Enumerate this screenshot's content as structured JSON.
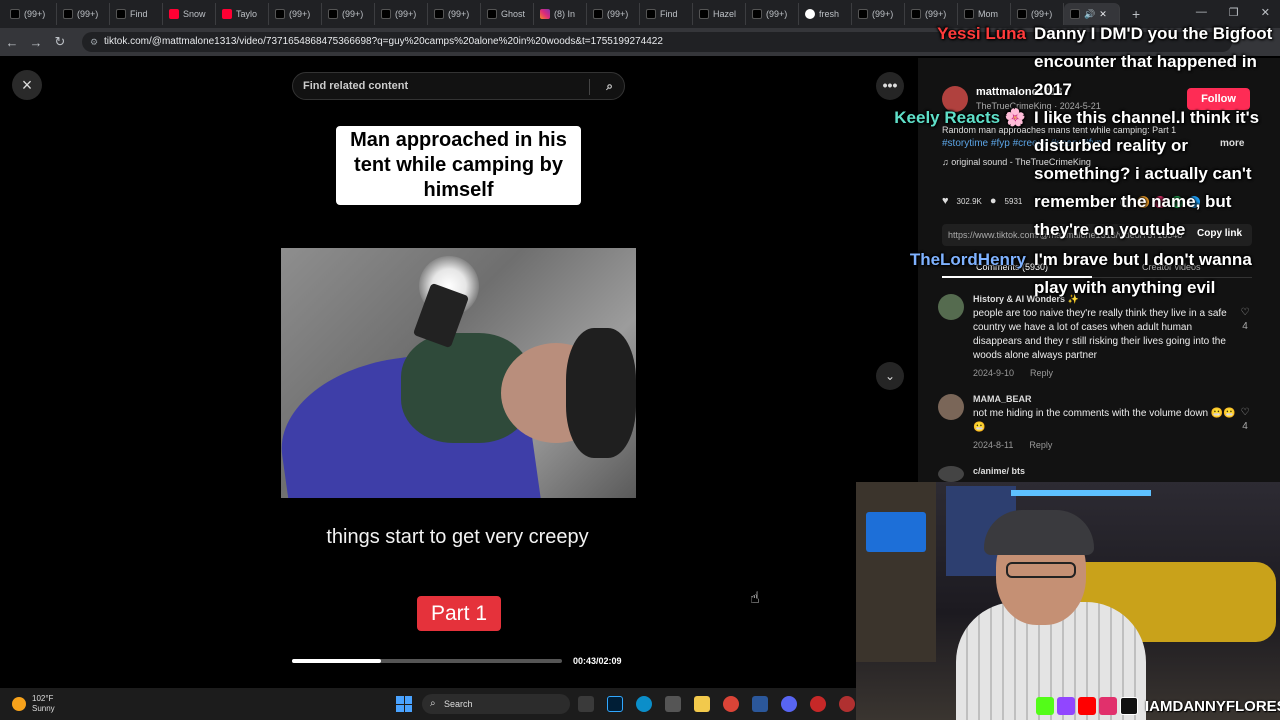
{
  "browser": {
    "tabs": [
      {
        "label": "(99+)",
        "icon": "tiktok"
      },
      {
        "label": "(99+)",
        "icon": "tiktok"
      },
      {
        "label": "Find",
        "icon": "tiktok"
      },
      {
        "label": "Snow",
        "icon": "youtube"
      },
      {
        "label": "Taylo",
        "icon": "youtube"
      },
      {
        "label": "(99+)",
        "icon": "tiktok"
      },
      {
        "label": "(99+)",
        "icon": "tiktok"
      },
      {
        "label": "(99+)",
        "icon": "tiktok"
      },
      {
        "label": "(99+)",
        "icon": "tiktok"
      },
      {
        "label": "Ghost",
        "icon": "tiktok"
      },
      {
        "label": "(8) In",
        "icon": "instagram"
      },
      {
        "label": "(99+)",
        "icon": "tiktok"
      },
      {
        "label": "Find",
        "icon": "tiktok"
      },
      {
        "label": "Hazel",
        "icon": "tiktok"
      },
      {
        "label": "(99+)",
        "icon": "tiktok"
      },
      {
        "label": "fresh",
        "icon": "google"
      },
      {
        "label": "(99+)",
        "icon": "tiktok"
      },
      {
        "label": "(99+)",
        "icon": "tiktok"
      },
      {
        "label": "Mom",
        "icon": "tiktok"
      },
      {
        "label": "(99+)",
        "icon": "tiktok"
      }
    ],
    "url": "tiktok.com/@mattmalone1313/video/7371654868475366698?q=guy%20camps%20alone%20in%20woods&t=1755199274422"
  },
  "viewer": {
    "close_icon": "×",
    "search_placeholder": "Find related content",
    "caption_top": "Man approached in his tent while camping by himself",
    "caption_bottom": "things start to get very creepy",
    "part_label": "Part 1",
    "progress_fraction": 0.33,
    "timecode": "00:43/02:09"
  },
  "post": {
    "username": "mattmalone1313",
    "display_meta": "TheTrueCrimeKing · 2024-5-21",
    "follow_label": "Follow",
    "description": "Random man approaches mans tent while camping: Part 1",
    "hashtags": "#storytime #fyp #creepy #scary #fyp",
    "more_label": "more",
    "sound": "original sound - TheTrueCrimeKing",
    "likes": "302.9K",
    "comments_count": "5931",
    "link": "https://www.tiktok.com/@mattmalone1313/video/73716548",
    "copy_link_label": "Copy link",
    "tab_comments": "Comments (5930)",
    "tab_creator": "Creator videos"
  },
  "comments": [
    {
      "user": "History & AI Wonders ✨",
      "text": "people are too naive they're really think they live in a safe country we have a lot of cases when adult human disappears and they r still risking their lives going into the woods alone always partner",
      "date": "2024-9-10",
      "reply": "Reply",
      "likes": "4"
    },
    {
      "user": "MAMA_BEAR",
      "text": "not me hiding in the comments with the volume down 😬😬😬",
      "date": "2024-8-11",
      "reply": "Reply",
      "likes": "4"
    },
    {
      "user": "c/anime/ bts",
      "text": "",
      "date": "",
      "reply": "",
      "likes": ""
    }
  ],
  "chat": [
    {
      "name": "Yessi Luna",
      "color": "#ff3b3b",
      "message": "Danny I DM'D you the Bigfoot encounter that happened in 2017"
    },
    {
      "name": "Keely Reacts 🌸",
      "color": "#5fe0c9",
      "message": "I like this channel.I think it's disturbed reality or something? i actually can't remember the name, but they're on youtube"
    },
    {
      "name": "TheLordHenry",
      "color": "#7fb2ff",
      "message": "I'm brave but I don't wanna play with anything evil"
    }
  ],
  "stream": {
    "handle": "IAMDANNYFLORES"
  },
  "taskbar": {
    "temperature": "102°F",
    "condition": "Sunny",
    "search_label": "Search"
  }
}
